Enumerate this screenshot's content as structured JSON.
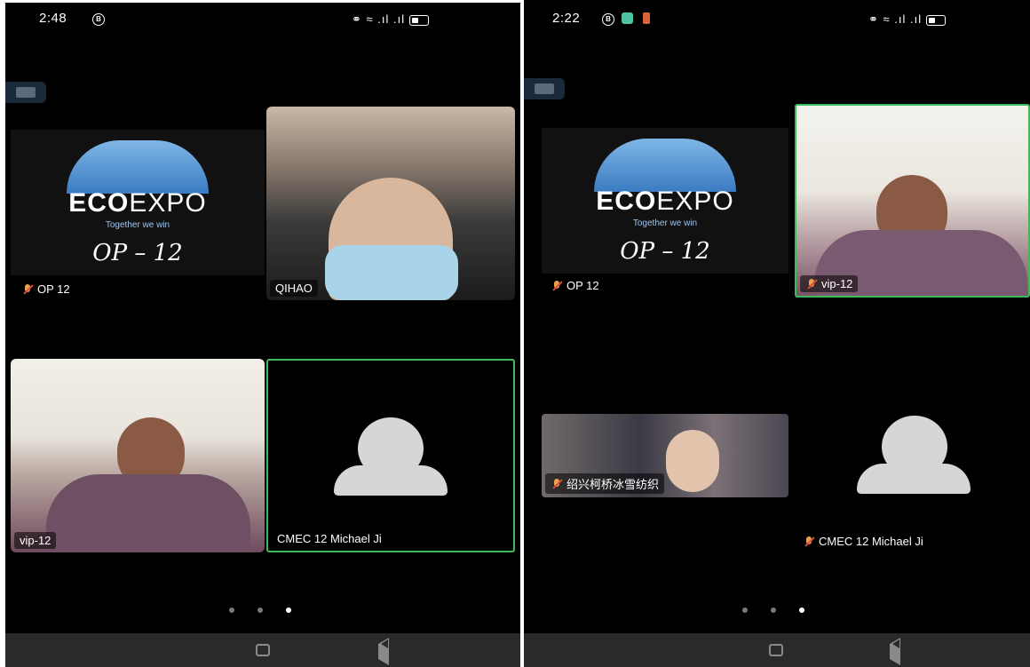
{
  "left": {
    "status": {
      "time": "2:48",
      "icon_notif": "B"
    },
    "tiles": {
      "op": {
        "logo_brand_bold": "ECO",
        "logo_brand_rest": "EXPO",
        "logo_tagline": "Together we win",
        "handwritten": "OP – 12",
        "name": "OP 12"
      },
      "qihao": {
        "name": "QIHAO"
      },
      "vip": {
        "name": "vip-12"
      },
      "cmec": {
        "name": "CMEC 12 Michael Ji"
      }
    },
    "pages": {
      "count": 3,
      "current": 3
    }
  },
  "right": {
    "status": {
      "time": "2:22",
      "icon_notif": "B"
    },
    "tiles": {
      "op": {
        "logo_brand_bold": "ECO",
        "logo_brand_rest": "EXPO",
        "logo_tagline": "Together we win",
        "handwritten": "OP – 12",
        "name": "OP 12"
      },
      "vip": {
        "name": "vip-12"
      },
      "shaoxing": {
        "name": "绍兴柯桥冰雪纺织"
      },
      "cmec": {
        "name": "CMEC 12 Michael Ji"
      }
    },
    "pages": {
      "count": 3,
      "current": 3
    }
  },
  "colors": {
    "active_speaker_border": "#3fba5a",
    "muted_icon": "#e04a3a"
  },
  "icons": [
    "headphones-icon",
    "wifi-icon",
    "signal-icon",
    "battery-icon",
    "book-icon",
    "mic-off-icon",
    "menu-nav-icon",
    "home-nav-icon",
    "back-nav-icon"
  ]
}
